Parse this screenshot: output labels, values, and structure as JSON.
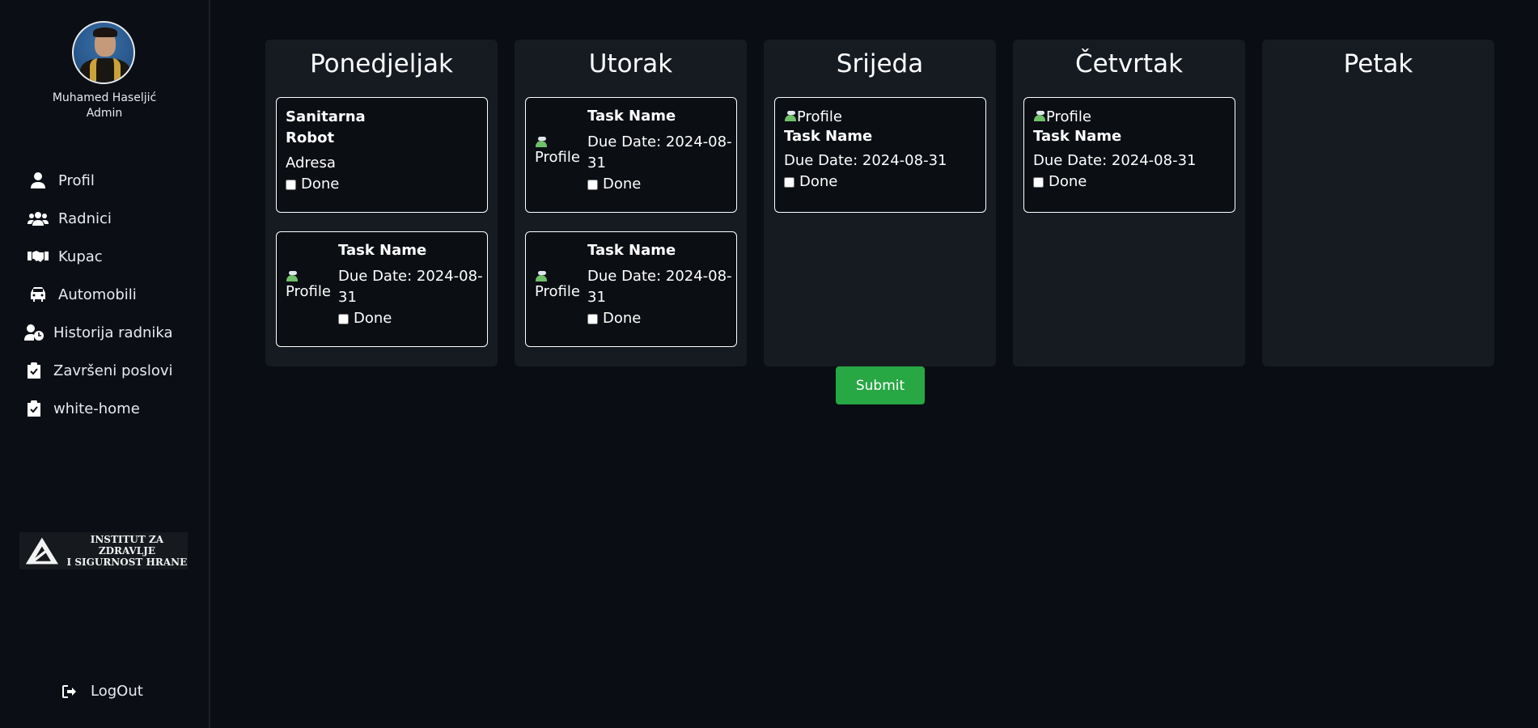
{
  "sidebar": {
    "user": {
      "name": "Muhamed Haseljić",
      "role": "Admin"
    },
    "items": [
      {
        "label": "Profil",
        "icon": "user-icon"
      },
      {
        "label": "Radnici",
        "icon": "users-icon"
      },
      {
        "label": "Kupac",
        "icon": "handshake-icon"
      },
      {
        "label": "Automobili",
        "icon": "car-icon"
      },
      {
        "label": "Historija radnika",
        "icon": "user-clock-icon"
      },
      {
        "label": "Završeni poslovi",
        "icon": "clipboard-check-icon"
      },
      {
        "label": "white-home",
        "icon": "clipboard-check-icon"
      }
    ],
    "logo": {
      "line1": "INSTITUT ZA ZDRAVLJE",
      "line2": "I SIGURNOST HRANE"
    },
    "logout": {
      "label": "LogOut",
      "icon": "sign-out-icon"
    }
  },
  "board": {
    "columns": [
      {
        "title": "Ponedjeljak",
        "cards": [
          {
            "title_line1": "Sanitarna",
            "title_line2": "Robot",
            "address": "Adresa",
            "done_label": "Done"
          },
          {
            "img_alt": "Profile",
            "title": "Task Name",
            "due_line1": "Due Date: 2024-08-",
            "due_line2": "31",
            "done_label": "Done"
          }
        ]
      },
      {
        "title": "Utorak",
        "cards": [
          {
            "img_alt": "Profile",
            "title": "Task Name",
            "due_line1": "Due Date: 2024-08-",
            "due_line2": "31",
            "done_label": "Done"
          },
          {
            "img_alt": "Profile",
            "title": "Task Name",
            "due_line1": "Due Date: 2024-08-",
            "due_line2": "31",
            "done_label": "Done"
          }
        ]
      },
      {
        "title": "Srijeda",
        "cards": [
          {
            "img_alt": "Profile",
            "title": "Task Name",
            "due": "Due Date: 2024-08-31",
            "done_label": "Done"
          }
        ]
      },
      {
        "title": "Četvrtak",
        "cards": [
          {
            "img_alt": "Profile",
            "title": "Task Name",
            "due": "Due Date: 2024-08-31",
            "done_label": "Done"
          }
        ]
      },
      {
        "title": "Petak",
        "cards": []
      }
    ],
    "submit_label": "Submit"
  },
  "colors": {
    "background": "#0a0e14",
    "column": "#161b22",
    "submit": "#28a745"
  }
}
